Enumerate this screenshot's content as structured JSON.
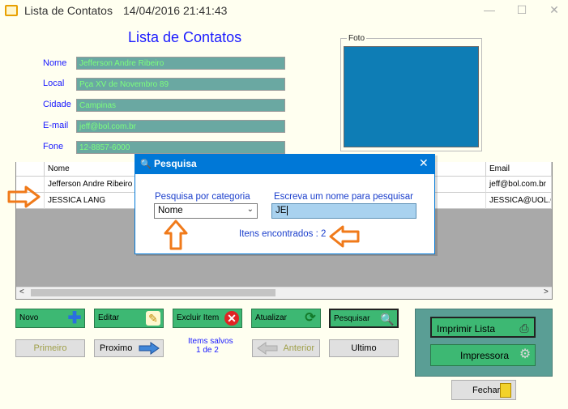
{
  "window": {
    "title": "Lista de Contatos",
    "datetime": "14/04/2016 21:41:43",
    "minimize": "—",
    "maximize": "☐",
    "close": "✕"
  },
  "form": {
    "title": "Lista de Contatos",
    "fields": {
      "nome": {
        "label": "Nome",
        "value": "Jefferson Andre Ribeiro"
      },
      "local": {
        "label": "Local",
        "value": "Pça XV de Novembro 89"
      },
      "cidade": {
        "label": "Cidade",
        "value": "Campinas"
      },
      "email": {
        "label": "E-mail",
        "value": "jeff@bol.com.br"
      },
      "fone": {
        "label": "Fone",
        "value": "12-8857-6000"
      }
    },
    "photo_label": "Foto"
  },
  "grid": {
    "headers": {
      "nome": "Nome",
      "email": "Email"
    },
    "rows": [
      {
        "nome": "Jefferson Andre Ribeiro",
        "email": "jeff@bol.com.br"
      },
      {
        "nome": "JESSICA LANG",
        "email": "JESSICA@UOL.COM"
      }
    ],
    "scroll_left": "<",
    "scroll_right": ">"
  },
  "buttons": {
    "novo": "Novo",
    "editar": "Editar",
    "excluir": "Excluir Item",
    "atualizar": "Atualizar",
    "pesquisar": "Pesquisar",
    "primeiro": "Primeiro",
    "proximo": "Proximo",
    "anterior": "Anterior",
    "ultimo": "Ultimo",
    "imprimir_lista": "Imprimir Lista",
    "impressora": "Impressora",
    "fechar": "Fechar"
  },
  "status": {
    "items_saved_label": "Items salvos",
    "items_saved_count": "1 de 2"
  },
  "dialog": {
    "title": "Pesquisa",
    "close": "✕",
    "category_label": "Pesquisa por categoria",
    "category_selected": "Nome",
    "search_label": "Escreva um nome para pesquisar",
    "search_value": "JE",
    "found_label": "Itens encontrados : 2"
  },
  "colors": {
    "accent_blue": "#1a1aff",
    "button_green": "#3db873",
    "annotation_orange": "#f07a1a",
    "dialog_blue": "#0078d7",
    "photo_blue": "#0e7db5"
  }
}
